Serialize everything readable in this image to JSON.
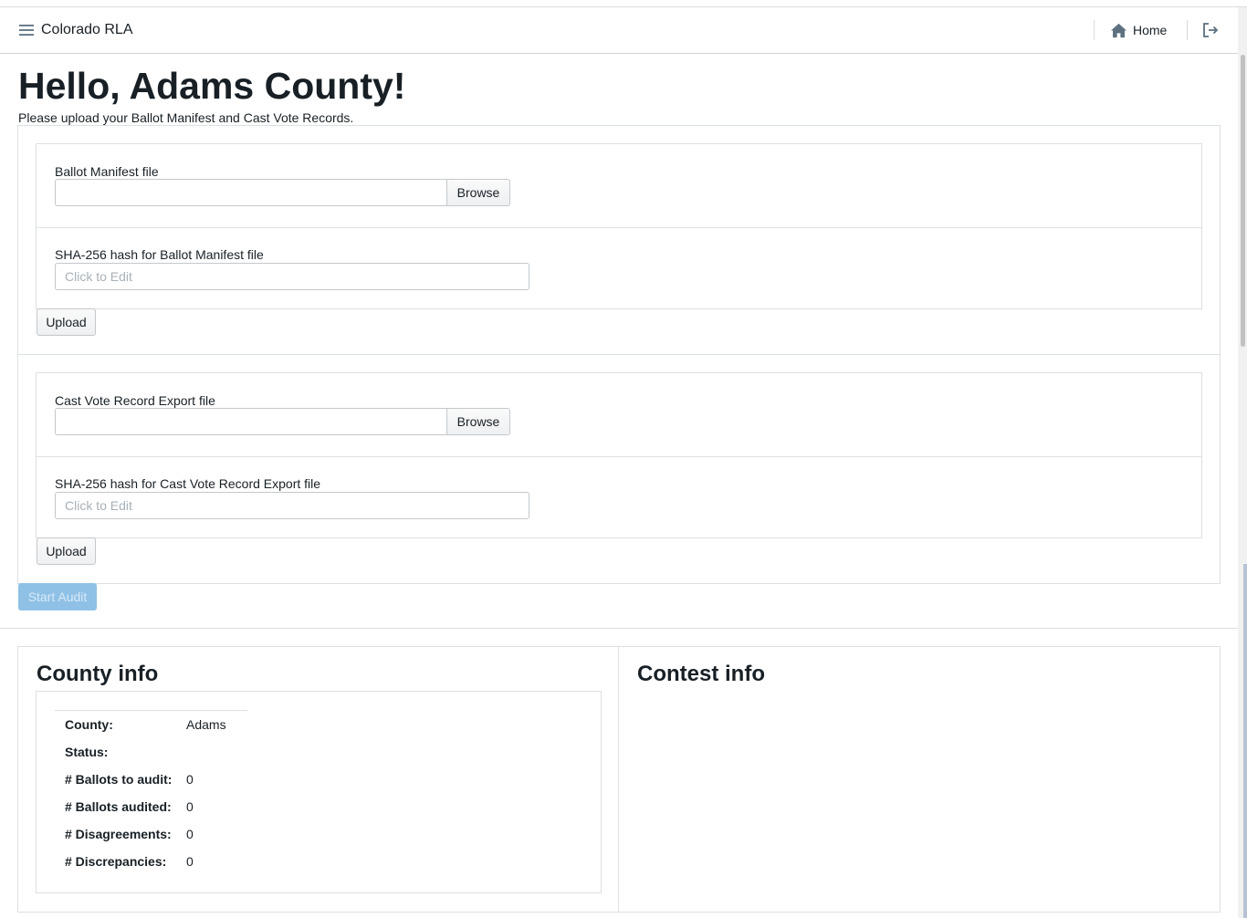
{
  "navbar": {
    "app_name": "Colorado RLA",
    "home_label": "Home"
  },
  "page": {
    "title": "Hello, Adams County!",
    "subtitle": "Please upload your Ballot Manifest and Cast Vote Records."
  },
  "ballot_manifest": {
    "file_label": "Ballot Manifest file",
    "browse_label": "Browse",
    "hash_label": "SHA-256 hash for Ballot Manifest file",
    "hash_placeholder": "Click to Edit",
    "upload_label": "Upload"
  },
  "cvr_export": {
    "file_label": "Cast Vote Record Export file",
    "browse_label": "Browse",
    "hash_label": "SHA-256 hash for Cast Vote Record Export file",
    "hash_placeholder": "Click to Edit",
    "upload_label": "Upload"
  },
  "start_audit_label": "Start Audit",
  "county_info": {
    "title": "County info",
    "rows": [
      {
        "label": "County:",
        "value": "Adams"
      },
      {
        "label": "Status:",
        "value": ""
      },
      {
        "label": "# Ballots to audit:",
        "value": "0"
      },
      {
        "label": "# Ballots audited:",
        "value": "0"
      },
      {
        "label": "# Disagreements:",
        "value": "0"
      },
      {
        "label": "# Discrepancies:",
        "value": "0"
      }
    ]
  },
  "contest_info": {
    "title": "Contest info"
  },
  "colors": {
    "primary_disabled": "#8fc1e6",
    "text": "#182026",
    "border": "#dbe0e4"
  }
}
